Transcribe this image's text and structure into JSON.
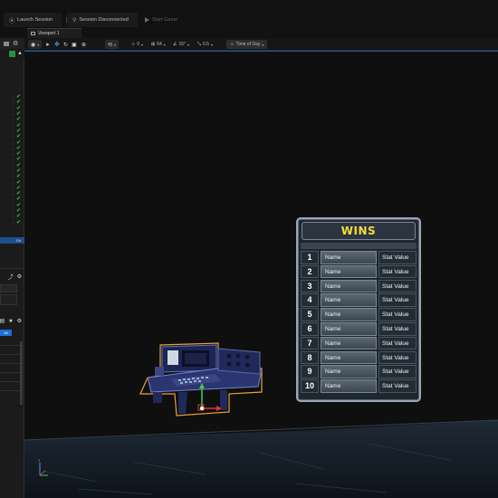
{
  "topbar": {
    "launch_label": "Launch Session",
    "session_label": "Session Disconnected",
    "start_label": "Start Game"
  },
  "viewport_tab": {
    "label": "Viewport 1"
  },
  "viewport_toolbar": {
    "snap_angle": "0",
    "grid_size": "64",
    "rotation_snap": "15°",
    "scale_snap": "0.5",
    "time_of_day_label": "Time of Day"
  },
  "left_panel": {
    "selected_item_label": "Dir",
    "blue_tag_label": "All",
    "checked_rows": 23
  },
  "board": {
    "title": "WINS",
    "title_color": "#f5dd3a",
    "rows": [
      {
        "rank": "1",
        "name": "Name",
        "stat": "Stat Value"
      },
      {
        "rank": "2",
        "name": "Name",
        "stat": "Stat Value"
      },
      {
        "rank": "3",
        "name": "Name",
        "stat": "Stat Value"
      },
      {
        "rank": "4",
        "name": "Name",
        "stat": "Stat Value"
      },
      {
        "rank": "5",
        "name": "Name",
        "stat": "Stat Value"
      },
      {
        "rank": "6",
        "name": "Name",
        "stat": "Stat Value"
      },
      {
        "rank": "7",
        "name": "Name",
        "stat": "Stat Value"
      },
      {
        "rank": "8",
        "name": "Name",
        "stat": "Stat Value"
      },
      {
        "rank": "9",
        "name": "Name",
        "stat": "Stat Value"
      },
      {
        "rank": "10",
        "name": "Name",
        "stat": "Stat Value"
      }
    ]
  },
  "colors": {
    "accent_blue": "#1d6fd3",
    "check_green": "#2fc05a",
    "selection_outline": "#e8a33a"
  }
}
